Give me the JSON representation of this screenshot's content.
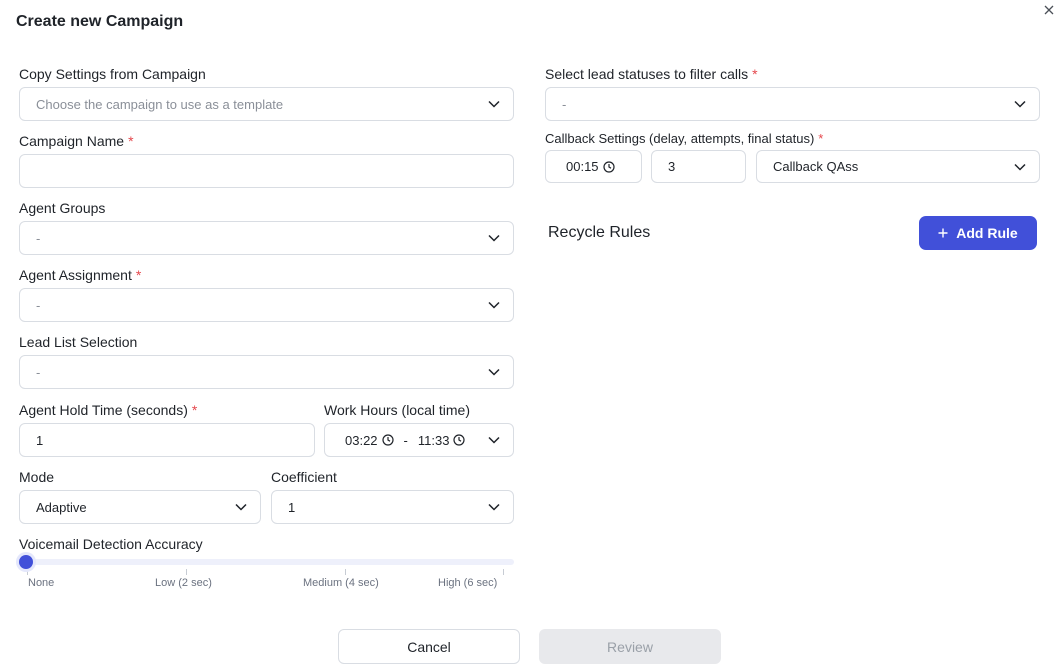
{
  "dialog": {
    "title": "Create new Campaign",
    "close_icon": "close-icon"
  },
  "left": {
    "copy_settings": {
      "label": "Copy Settings from Campaign",
      "placeholder": "Choose the campaign to use as a template"
    },
    "campaign_name": {
      "label": "Campaign Name",
      "required_mark": "*",
      "value": ""
    },
    "agent_groups": {
      "label": "Agent Groups",
      "value": "-"
    },
    "agent_assignment": {
      "label": "Agent Assignment",
      "required_mark": "*",
      "value": "-"
    },
    "lead_list": {
      "label": "Lead List Selection",
      "value": "-"
    },
    "hold_time": {
      "label": "Agent Hold Time (seconds)",
      "required_mark": "*",
      "value": "1"
    },
    "work_hours": {
      "label": "Work Hours (local time)",
      "start": "03:22",
      "separator": "-",
      "end": "11:33"
    },
    "mode": {
      "label": "Mode",
      "value": "Adaptive"
    },
    "coefficient": {
      "label": "Coefficient",
      "value": "1"
    },
    "voicemail": {
      "label": "Voicemail Detection Accuracy",
      "level": 0,
      "ticks": [
        "None",
        "Low (2 sec)",
        "Medium (4 sec)",
        "High (6 sec)"
      ]
    }
  },
  "right": {
    "lead_statuses": {
      "label": "Select lead statuses to filter calls",
      "required_mark": "*",
      "value": "-"
    },
    "callback": {
      "label": "Callback Settings (delay, attempts, final status)",
      "required_mark": "*",
      "delay": "00:15",
      "attempts": "3",
      "final_status": "Callback QAss"
    },
    "recycle_rules": {
      "title": "Recycle Rules",
      "add_label": "Add Rule"
    }
  },
  "footer": {
    "cancel_label": "Cancel",
    "review_label": "Review"
  },
  "colors": {
    "accent": "#4150d9",
    "required": "#e5484d",
    "border": "#d9dde3",
    "disabled_bg": "#e8e9ec"
  }
}
